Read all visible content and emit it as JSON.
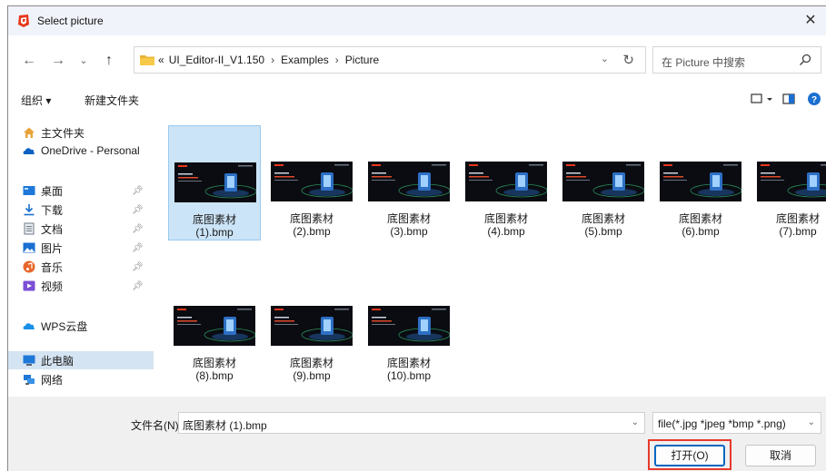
{
  "window": {
    "title": "Select picture"
  },
  "address": {
    "overflow": "«",
    "crumbs": [
      "UI_Editor-II_V1.150",
      "Examples",
      "Picture"
    ],
    "separator": "›"
  },
  "search": {
    "placeholder": "在 Picture 中搜索"
  },
  "toolbar": {
    "organize_label": "组织 ▾",
    "new_folder_label": "新建文件夹"
  },
  "nav": {
    "items": [
      {
        "label": "主文件夹",
        "icon": "home-icon"
      },
      {
        "label": "OneDrive - Personal",
        "icon": "cloud-icon"
      },
      {
        "label": "桌面",
        "icon": "desktop-icon",
        "pinned": true
      },
      {
        "label": "下载",
        "icon": "download-icon",
        "pinned": true
      },
      {
        "label": "文档",
        "icon": "document-icon",
        "pinned": true
      },
      {
        "label": "图片",
        "icon": "pictures-icon",
        "pinned": true
      },
      {
        "label": "音乐",
        "icon": "music-icon",
        "pinned": true
      },
      {
        "label": "视频",
        "icon": "video-icon",
        "pinned": true
      },
      {
        "label": "WPS云盘",
        "icon": "wps-cloud-icon"
      },
      {
        "label": "此电脑",
        "icon": "computer-icon",
        "selected": true
      },
      {
        "label": "网络",
        "icon": "network-icon"
      }
    ]
  },
  "files": [
    {
      "name_line1": "底图素材",
      "name_line2": "(1).bmp",
      "selected": true
    },
    {
      "name_line1": "底图素材",
      "name_line2": "(2).bmp"
    },
    {
      "name_line1": "底图素材",
      "name_line2": "(3).bmp"
    },
    {
      "name_line1": "底图素材",
      "name_line2": "(4).bmp"
    },
    {
      "name_line1": "底图素材",
      "name_line2": "(5).bmp"
    },
    {
      "name_line1": "底图素材",
      "name_line2": "(6).bmp"
    },
    {
      "name_line1": "底图素材",
      "name_line2": "(7).bmp"
    },
    {
      "name_line1": "底图素材",
      "name_line2": "(8).bmp"
    },
    {
      "name_line1": "底图素材",
      "name_line2": "(9).bmp"
    },
    {
      "name_line1": "底图素材",
      "name_line2": "(10).bmp"
    }
  ],
  "bottom": {
    "filename_label": "文件名(N):",
    "filename_value": "底图素材 (1).bmp",
    "filter_value": "file(*.jpg *jpeg *bmp *.png)",
    "open_label": "打开(O)",
    "cancel_label": "取消"
  },
  "colors": {
    "accent": "#0067c0",
    "selection": "#cce4f7",
    "highlight_box": "#e53a2b",
    "app_icon": "#e8371b"
  }
}
